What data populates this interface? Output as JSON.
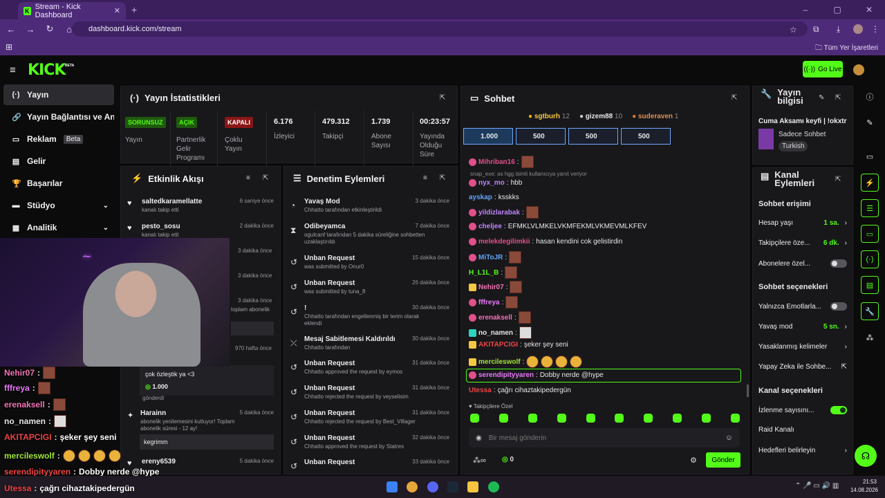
{
  "browser": {
    "tab_title": "Stream - Kick Dashboard",
    "url": "dashboard.kick.com/stream",
    "bookmarks_label": "Tüm Yer İşaretleri"
  },
  "header": {
    "logo": "KICK",
    "beta": "BETA",
    "go_live": "Go Live"
  },
  "sidebar": {
    "items": [
      {
        "label": "Yayın",
        "icon": "broadcast-icon"
      },
      {
        "label": "Yayın Bağlantısı ve Anahtar",
        "icon": "link-icon"
      },
      {
        "label": "Reklam",
        "badge": "Beta",
        "icon": "ad-icon"
      },
      {
        "label": "Gelir",
        "icon": "revenue-icon"
      },
      {
        "label": "Başarılar",
        "icon": "trophy-icon"
      },
      {
        "label": "Stüdyo",
        "icon": "studio-icon"
      },
      {
        "label": "Analitik",
        "icon": "analytics-icon"
      }
    ]
  },
  "stats": {
    "title": "Yayın İstatistikleri",
    "items": [
      {
        "tag": "SORUNSUZ",
        "label": "Yayın"
      },
      {
        "tag": "AÇIK",
        "label": "Partnerlik Gelir Programı"
      },
      {
        "tag": "KAPALI",
        "label": "Çoklu Yayın"
      },
      {
        "value": "6.176",
        "label": "İzleyici"
      },
      {
        "value": "479.312",
        "label": "Takipçi"
      },
      {
        "value": "1.739",
        "label": "Abone Sayısı"
      },
      {
        "value": "00:23:57",
        "label": "Yayında Olduğu Süre"
      }
    ]
  },
  "activity": {
    "title": "Etkinlik Akışı",
    "items": [
      {
        "name": "saltedkaramellatte",
        "sub": "kanalı takip etti",
        "time": "6 saniye önce"
      },
      {
        "name": "pesto_sosu",
        "sub": "kanalı takip etti",
        "time": "2 dakika önce"
      },
      {
        "time": "3 dakika önce"
      },
      {
        "time": "3 dakika önce"
      },
      {
        "time": "3 dakika önce",
        "sub": "toplam abonelik"
      },
      {
        "time": "970 hafta önce"
      },
      {
        "msg": "çok özleştik ya <3",
        "amount": "1.000",
        "sent": "gönderdi"
      },
      {
        "name": "Harainn",
        "sub": "abonelik yenilemesini kutluyor! Toplam abonelik süresi - 12 ay!",
        "time": "5 dakika önce",
        "msg": "kegrimm"
      },
      {
        "name": "ereny6539",
        "time": "5 dakika önce"
      }
    ]
  },
  "moderation": {
    "title": "Denetim Eylemleri",
    "items": [
      {
        "name": "Yavaş Mod",
        "sub": "Chhatto tarafından etkinleştirildi",
        "time": "3 dakika önce"
      },
      {
        "name": "Odibeyamca",
        "sub": "ogulcanf tarafından 5 dakika süreliğine sohbetten uzaklaştırıldı",
        "time": "7 dakika önce"
      },
      {
        "name": "Unban Request",
        "sub": "was submitted by Onur0",
        "time": "15 dakika önce"
      },
      {
        "name": "Unban Request",
        "sub": "was submitted by tuna_8",
        "time": "26 dakika önce"
      },
      {
        "name": "!",
        "sub": "Chhatto tarafından engellenmiş bir terim olarak eklendi",
        "time": "30 dakika önce"
      },
      {
        "name": "Mesaj Sabitlemesi Kaldırıldı",
        "sub": "Chhatto tarafından",
        "time": "30 dakika önce"
      },
      {
        "name": "Unban Request",
        "sub": "Chhatto approved the request by eymos",
        "time": "31 dakika önce"
      },
      {
        "name": "Unban Request",
        "sub": "Chhatto rejected the request by veyselisim",
        "time": "31 dakika önce"
      },
      {
        "name": "Unban Request",
        "sub": "Chhatto rejected the request by Best_Villager",
        "time": "31 dakika önce"
      },
      {
        "name": "Unban Request",
        "sub": "Chhatto approved the request by Statres",
        "time": "32 dakika önce"
      },
      {
        "name": "Unban Request",
        "time": "33 dakika önce"
      }
    ]
  },
  "chat": {
    "title": "Sohbet",
    "top_gifters": [
      {
        "name": "sgtburh",
        "count": "12"
      },
      {
        "name": "gizem88",
        "count": "10"
      },
      {
        "name": "suderaven",
        "count": "1"
      }
    ],
    "goals": [
      "1.000",
      "500",
      "500",
      "500"
    ],
    "reply_note": "snap_exe: as hgg isimli kullanıcıya yanıt veriyor",
    "messages": [
      {
        "user": "Mihriban16",
        "text": "",
        "color": "#e0508a"
      },
      {
        "user": "nyx_mo",
        "text": "hbb",
        "color": "#c084fc"
      },
      {
        "user": "ayskap",
        "text": "ksskks",
        "color": "#60a5fa"
      },
      {
        "user": "yildizlarabak",
        "text": "",
        "color": "#c084fc"
      },
      {
        "user": "cheljee",
        "text": "EFMKLVLMKELVKMFEKMLVKMEVMLKFEV",
        "color": "#c084fc"
      },
      {
        "user": "melekdegilimkii",
        "text": "hasan kendini cok gelistirdin",
        "color": "#e0508a"
      },
      {
        "user": "MiToJR",
        "text": "",
        "color": "#60a5fa"
      },
      {
        "user": "H_L1L_B",
        "text": "",
        "color": "#53fc18"
      },
      {
        "user": "Nehir07",
        "text": "",
        "color": "#f472b6"
      },
      {
        "user": "fffreya",
        "text": "",
        "color": "#e879f9"
      },
      {
        "user": "erenaksell",
        "text": "",
        "color": "#f472b6"
      },
      {
        "user": "no_namen",
        "text": "",
        "color": "#e5e5e5"
      },
      {
        "user": "AKITAPCIGI",
        "text": "şeker şey seni",
        "color": "#ef4444"
      },
      {
        "user": "mercileswolf",
        "text": "",
        "color": "#a3e635"
      },
      {
        "user": "serendipityyaren",
        "text": "Dobby nerde @hype",
        "color": "#e879f9"
      },
      {
        "user": "Utessa",
        "text": "çağrı cihaztakipedergün",
        "color": "#ef4444"
      }
    ],
    "followers_only": "Takipçilere Özel",
    "input_placeholder": "Bir mesaj gönderin",
    "points": "0",
    "send": "Gönder"
  },
  "info": {
    "title": "Yayın bilgisi",
    "stream_title": "Cuma Aksamı keyfi | !okxtr",
    "category": "Sadece Sohbet",
    "tag": "Turkish"
  },
  "channel_actions": {
    "title": "Kanal Eylemleri",
    "access_title": "Sohbet erişimi",
    "access": [
      {
        "label": "Hesap yaşı",
        "value": "1 sa."
      },
      {
        "label": "Takipçilere öze...",
        "value": "6 dk."
      },
      {
        "label": "Abonelere özel...",
        "toggle": false
      }
    ],
    "options_title": "Sohbet seçenekleri",
    "options": [
      {
        "label": "Yalnızca Emotlarla...",
        "toggle": false
      },
      {
        "label": "Yavaş mod",
        "value": "5 sn."
      },
      {
        "label": "Yasaklanmış kelimeler"
      },
      {
        "label": "Yapay Zeka ile Sohbe..."
      }
    ],
    "channel_title": "Kanal seçenekleri",
    "channel": [
      {
        "label": "İzlenme sayısını...",
        "toggle": true
      },
      {
        "label": "Raid Kanalı"
      },
      {
        "label": "Hedefleri belirleyin"
      }
    ]
  },
  "overlay": {
    "messages": [
      {
        "user": "Nehir07",
        "text": "",
        "color": "#f472b6"
      },
      {
        "user": "fffreya",
        "text": "",
        "color": "#e879f9"
      },
      {
        "user": "erenaksell",
        "text": "",
        "color": "#f472b6"
      },
      {
        "user": "no_namen",
        "text": "",
        "color": "#e5e5e5"
      },
      {
        "user": "AKITAPCIGI",
        "text": "şeker şey seni",
        "color": "#ef4444"
      },
      {
        "user": "mercileswolf",
        "text": "",
        "color": "#a3e635"
      },
      {
        "user": "serendipityyaren",
        "text": "Dobby nerde @hype",
        "color": "#ef4444"
      },
      {
        "user": "Utessa",
        "text": "çağrı cihaztakipedergün",
        "color": "#ef4444"
      }
    ]
  },
  "taskbar": {
    "time": "21:53",
    "date": "14.08.2026"
  },
  "colors": {
    "accent": "#53fc18",
    "panel": "#18181b",
    "browser": "#4e2b79"
  }
}
